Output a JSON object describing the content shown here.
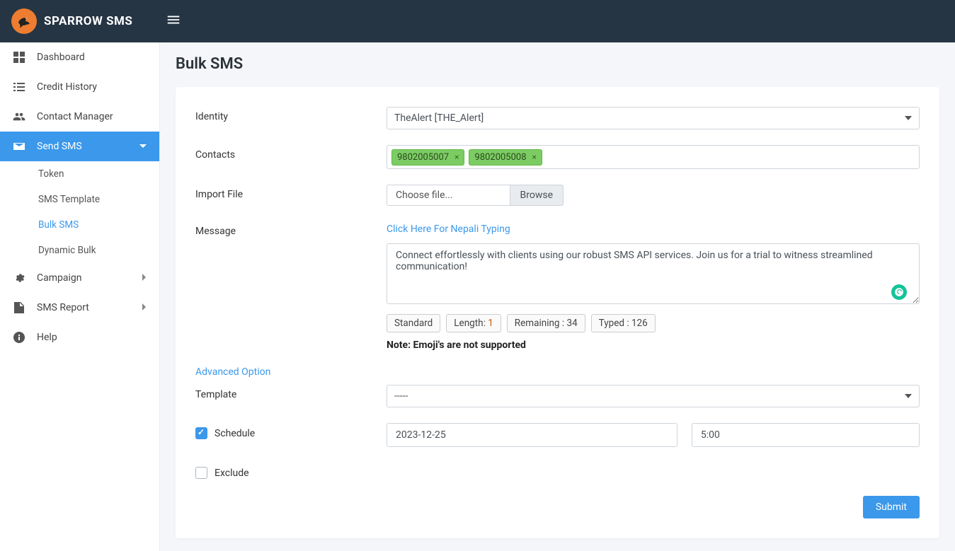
{
  "brand": "SPARROW SMS",
  "sidebar": {
    "items": [
      {
        "label": "Dashboard",
        "icon": "dashboard"
      },
      {
        "label": "Credit History",
        "icon": "list"
      },
      {
        "label": "Contact Manager",
        "icon": "users"
      },
      {
        "label": "Send SMS",
        "icon": "envelope",
        "active": true
      },
      {
        "label": "Campaign",
        "icon": "gear",
        "chevron": true
      },
      {
        "label": "SMS Report",
        "icon": "file",
        "chevron": true
      },
      {
        "label": "Help",
        "icon": "info"
      }
    ],
    "subs": [
      {
        "label": "Token"
      },
      {
        "label": "SMS Template"
      },
      {
        "label": "Bulk SMS",
        "active": true
      },
      {
        "label": "Dynamic Bulk"
      }
    ]
  },
  "page": {
    "title": "Bulk SMS",
    "labels": {
      "identity": "Identity",
      "contacts": "Contacts",
      "importFile": "Import File",
      "message": "Message",
      "template": "Template",
      "schedule": "Schedule",
      "exclude": "Exclude"
    },
    "identity_value": "TheAlert [THE_Alert]",
    "contacts": [
      "9802005007",
      "9802005008"
    ],
    "file": {
      "text": "Choose file...",
      "btn": "Browse"
    },
    "nepali_link": "Click Here For Nepali Typing",
    "message_text": "Connect effortlessly with clients using our robust SMS API services. Join us for a trial to witness streamlined communication!",
    "stats": {
      "mode": "Standard",
      "length_label": "Length: ",
      "length_val": "1",
      "remaining": "Remaining : 34",
      "typed": "Typed : 126"
    },
    "note": "Note: Emoji's are not supported",
    "advanced": "Advanced Option",
    "template_value": "-----",
    "schedule_date": "2023-12-25",
    "schedule_time": "5:00",
    "submit": "Submit"
  }
}
